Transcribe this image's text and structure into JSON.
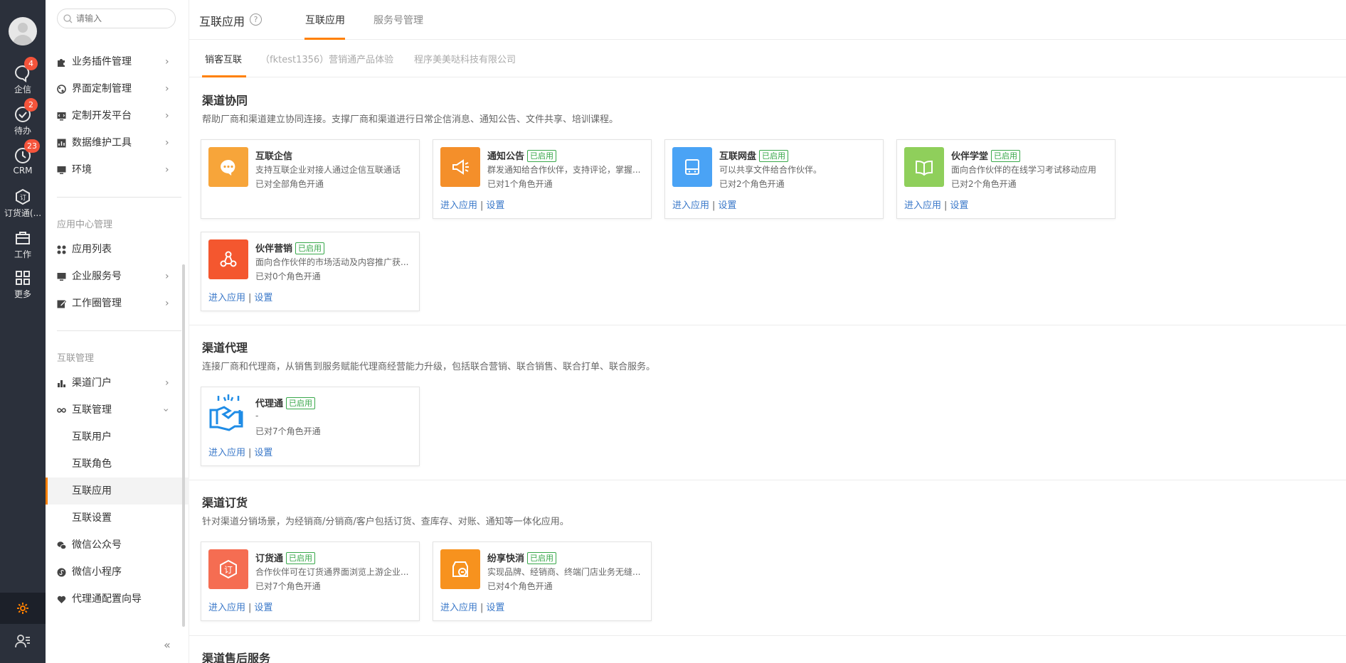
{
  "rail": {
    "items": [
      {
        "label": "企信",
        "badge": "4",
        "icon": "chat-bubble-icon"
      },
      {
        "label": "待办",
        "badge": "2",
        "icon": "check-circle-icon"
      },
      {
        "label": "CRM",
        "badge": "23",
        "icon": "clock-icon"
      },
      {
        "label": "订货通(...",
        "badge": "",
        "icon": "order-box-icon"
      },
      {
        "label": "工作",
        "badge": "",
        "icon": "briefcase-icon"
      },
      {
        "label": "更多",
        "badge": "",
        "icon": "grid-icon"
      }
    ],
    "accent": "#ff8000",
    "bg": "#2b303b"
  },
  "sidebar": {
    "search_placeholder": "请输入",
    "top_items": [
      {
        "label": "业务插件管理"
      },
      {
        "label": "界面定制管理"
      },
      {
        "label": "定制开发平台"
      },
      {
        "label": "数据维护工具"
      },
      {
        "label": "环境"
      }
    ],
    "group_app_center": "应用中心管理",
    "app_center_items": [
      {
        "label": "应用列表"
      },
      {
        "label": "企业服务号"
      },
      {
        "label": "工作圈管理"
      }
    ],
    "group_interconnect": "互联管理",
    "interconnect_items": [
      {
        "label": "渠道门户"
      },
      {
        "label": "互联管理"
      }
    ],
    "interconnect_sub": [
      {
        "label": "互联用户"
      },
      {
        "label": "互联角色"
      },
      {
        "label": "互联应用"
      },
      {
        "label": "互联设置"
      }
    ],
    "bottom_items": [
      {
        "label": "微信公众号"
      },
      {
        "label": "微信小程序"
      },
      {
        "label": "代理通配置向导"
      }
    ],
    "collapse": "«"
  },
  "topbar": {
    "title": "互联应用",
    "help": "?",
    "tabs": [
      {
        "label": "互联应用"
      },
      {
        "label": "服务号管理"
      }
    ]
  },
  "subtabs": [
    {
      "label": "销客互联"
    },
    {
      "label": "（fktest1356）营销通产品体验"
    },
    {
      "label": "程序美美哒科技有限公司"
    }
  ],
  "common": {
    "enabled_tag": "已启用",
    "enter": "进入应用",
    "sep": "|",
    "settings": "设置"
  },
  "sections": [
    {
      "title": "渠道协同",
      "desc": "帮助厂商和渠道建立协同连接。支撑厂商和渠道进行日常企信消息、通知公告、文件共享、培训课程。",
      "cards": [
        {
          "name": "互联企信",
          "desc": "支持互联企业对接人通过企信互联通话",
          "roles": "已对全部角色开通",
          "color": "#f7a53a",
          "icon": "chat-bubble-icon",
          "enabled": false,
          "links": false
        },
        {
          "name": "通知公告",
          "desc": "群发通知给合作伙伴，支持评论，掌握...",
          "roles": "已对1个角色开通",
          "color": "#f48f2a",
          "icon": "megaphone-icon",
          "enabled": true,
          "links": true
        },
        {
          "name": "互联网盘",
          "desc": "可以共享文件给合作伙伴。",
          "roles": "已对2个角色开通",
          "color": "#4aa3f5",
          "icon": "hard-drive-icon",
          "enabled": true,
          "links": true
        },
        {
          "name": "伙伴学堂",
          "desc": "面向合作伙伴的在线学习考试移动应用",
          "roles": "已对2个角色开通",
          "color": "#8fcf5b",
          "icon": "book-icon",
          "enabled": true,
          "links": true
        },
        {
          "name": "伙伴营销",
          "desc": "面向合作伙伴的市场活动及内容推广获...",
          "roles": "已对0个角色开通",
          "color": "#f4572f",
          "icon": "network-icon",
          "enabled": true,
          "links": true
        }
      ]
    },
    {
      "title": "渠道代理",
      "desc": "连接厂商和代理商，从销售到服务赋能代理商经营能力升级，包括联合营销、联合销售、联合打单、联合服务。",
      "cards": [
        {
          "name": "代理通",
          "desc": "-",
          "roles": "已对7个角色开通",
          "color": "#ffffff",
          "icon": "handshake-icon",
          "enabled": true,
          "links": true
        }
      ]
    },
    {
      "title": "渠道订货",
      "desc": "针对渠道分销场景，为经销商/分销商/客户包括订货、查库存、对账、通知等一体化应用。",
      "cards": [
        {
          "name": "订货通",
          "desc": "合作伙伴可在订货通界面浏览上游企业...",
          "roles": "已对7个角色开通",
          "color": "#f56d52",
          "icon": "order-box-icon",
          "enabled": true,
          "links": true
        },
        {
          "name": "纷享快消",
          "desc": "实现品牌、经销商、终端门店业务无缝...",
          "roles": "已对4个角色开通",
          "color": "#f7921e",
          "icon": "store-link-icon",
          "enabled": true,
          "links": true
        }
      ]
    },
    {
      "title": "渠道售后服务",
      "desc": "",
      "cards": []
    }
  ]
}
